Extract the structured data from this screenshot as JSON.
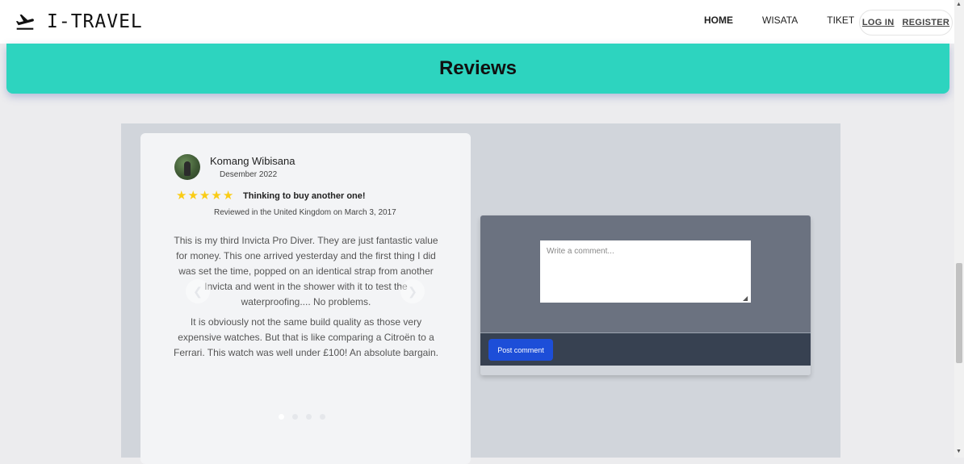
{
  "navbar": {
    "brand": "I-TRAVEL",
    "brand_icon": "airplane-departure-icon",
    "links": [
      {
        "label": "HOME",
        "active": true
      },
      {
        "label": "WISATA",
        "active": false
      },
      {
        "label": "TIKET",
        "active": false
      }
    ],
    "login": "LOG IN",
    "register": "REGISTER"
  },
  "banner": {
    "title": "Reviews"
  },
  "review": {
    "reviewer": "Komang Wibisana",
    "date": "Desember 2022",
    "rating": 5,
    "title": "Thinking to buy another one!",
    "meta": "Reviewed in the United Kingdom on March 3, 2017",
    "body": [
      "This is my third Invicta Pro Diver. They are just fantastic value for money. This one arrived yesterday and the first thing I did was set the time, popped on an identical strap from another Invicta and went in the shower with it to test the waterproofing.... No problems.",
      "It is obviously not the same build quality as those very expensive watches. But that is like comparing a Citroën to a Ferrari. This watch was well under £100! An absolute bargain."
    ],
    "carousel": {
      "prev_icon": "chevron-left-icon",
      "next_icon": "chevron-right-icon",
      "slides": 4,
      "active_slide": 0
    }
  },
  "comment": {
    "placeholder": "Write a comment...",
    "value": "",
    "submit_label": "Post comment"
  },
  "colors": {
    "accent": "#2dd4bf",
    "primary_button": "#1d4ed8",
    "star": "#facc15"
  }
}
